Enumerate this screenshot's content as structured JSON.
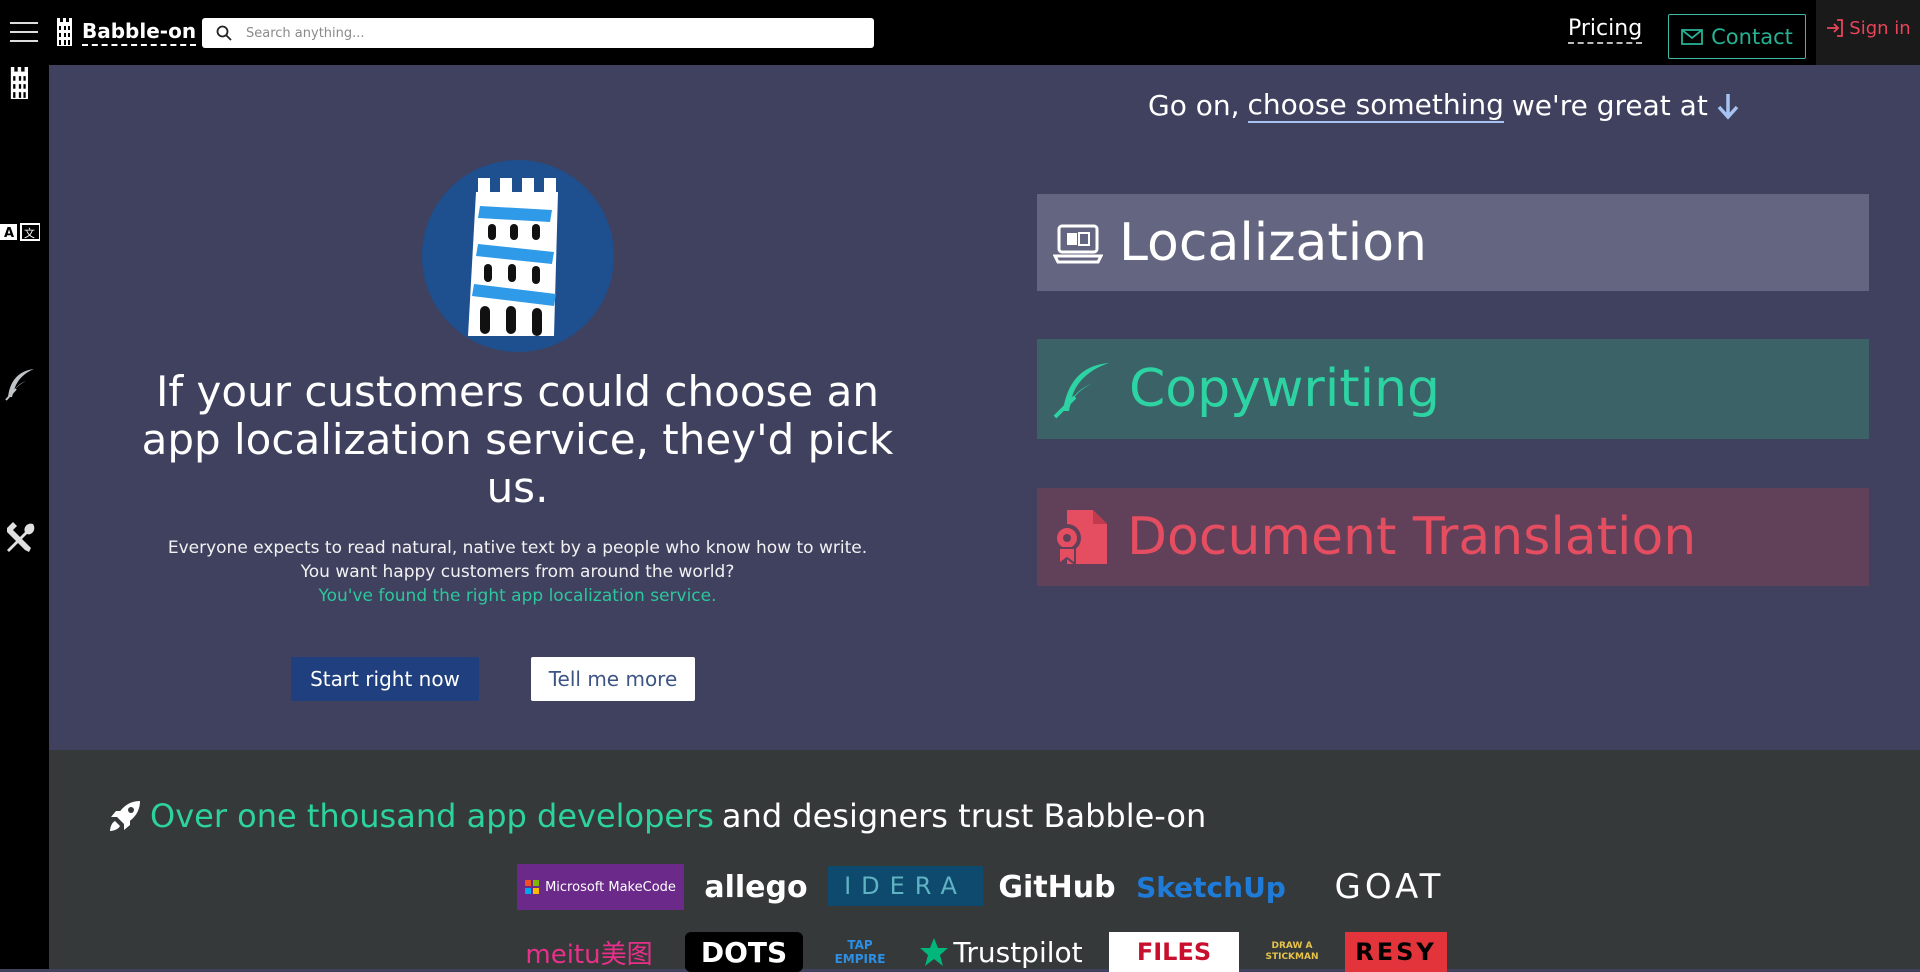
{
  "header": {
    "brand": "Babble-on",
    "search_placeholder": "Search anything...",
    "pricing": "Pricing",
    "contact": "Contact",
    "signin": "Sign in"
  },
  "hero": {
    "headline": "If your customers could choose an app localization service, they'd pick us.",
    "sub_line1": "Everyone expects to read natural, native text by a people who know how to write.",
    "sub_line2": "You want happy customers from around the world?",
    "sub_line3": "You've found the right app localization service.",
    "start_button": "Start right now",
    "more_button": "Tell me more"
  },
  "services": {
    "prompt_prefix": "Go on,",
    "prompt_link": "choose something",
    "prompt_suffix": "we're great at",
    "items": [
      {
        "label": "Localization",
        "icon": "laptop-translate-icon"
      },
      {
        "label": "Copywriting",
        "icon": "feather-icon"
      },
      {
        "label": "Document Translation",
        "icon": "certificate-document-icon"
      }
    ]
  },
  "trust": {
    "title_accent": "Over one thousand app developers",
    "title_rest": "and designers trust Babble-on",
    "logos_row1": [
      "Microsoft MakeCode",
      "allego",
      "IDERA",
      "GitHub",
      "SketchUp",
      "GOAT"
    ],
    "logos_row2": [
      "meitu美图",
      "DOTS",
      "TAP EMPIRE",
      "Trustpilot",
      "FILES",
      "DRAW A STICKMAN",
      "RESY"
    ]
  },
  "colors": {
    "bg": "#3f415f",
    "accent_green": "#2cd39a",
    "accent_red": "#e54d61",
    "navy": "#1f3f7e"
  }
}
